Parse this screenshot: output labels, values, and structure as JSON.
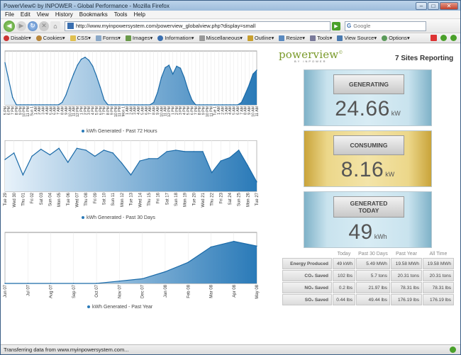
{
  "window": {
    "title": "PowerView© by INPOWER - Global Performance - Mozilla Firefox",
    "min": "–",
    "max": "□",
    "close": "✕"
  },
  "menu": [
    "File",
    "Edit",
    "View",
    "History",
    "Bookmarks",
    "Tools",
    "Help"
  ],
  "nav": {
    "back_icon": "back-arrow-icon",
    "url": "http://www.myinpowersystem.com/powerview_globalview.php?display=small",
    "search_placeholder": "Google",
    "search_engine": "G"
  },
  "devbar": [
    "Disable",
    "Cookies",
    "CSS",
    "Forms",
    "Images",
    "Information",
    "Miscellaneous",
    "Outline",
    "Resize",
    "Tools",
    "View Source",
    "Options"
  ],
  "status": "Transferring data from www.myinpowersystem.com...",
  "logo": {
    "name": "powerview",
    "mark": "©",
    "sub": "BY INPOWER"
  },
  "sites_reporting": "7 Sites Reporting",
  "panels": {
    "generating": {
      "label": "GENERATING",
      "value": "24.66",
      "unit": "kW"
    },
    "consuming": {
      "label": "CONSUMING",
      "value": "8.16",
      "unit": "kW"
    },
    "generated_today": {
      "label_line1": "GENERATED",
      "label_line2": "TODAY",
      "value": "49",
      "unit": "kWh"
    }
  },
  "stats": {
    "headers": [
      "Today",
      "Past 30 Days",
      "Past Year",
      "All Time"
    ],
    "rows": [
      {
        "label": "Energy Produced",
        "values": [
          "49 kWh",
          "5.49 MWh",
          "19.58 MWh",
          "19.58 MWh"
        ]
      },
      {
        "label": "CO₂ Saved",
        "values": [
          "102 lbs",
          "5.7 tons",
          "20.31 tons",
          "20.31 tons"
        ]
      },
      {
        "label": "NO₂ Saved",
        "values": [
          "0.2 lbs",
          "21.97 lbs",
          "78.31 lbs",
          "78.31 lbs"
        ]
      },
      {
        "label": "SO₂ Saved",
        "values": [
          "0.44 lbs",
          "49.44 lbs",
          "176.19 lbs",
          "176.19 lbs"
        ]
      }
    ]
  },
  "colors": {
    "fill": "#2a7ab8",
    "fill_light": "#e8f2fa",
    "line": "#1a6aa8",
    "gold": "#e6cf80",
    "blue_panel": "#c9e3ee"
  },
  "chart_data": [
    {
      "type": "area",
      "legend": "kWh Generated - Past 72 Hours",
      "x": [
        "5 PM",
        "6 PM",
        "7 PM",
        "8 PM",
        "9 PM",
        "10 PM",
        "11 PM",
        "Sun 1",
        "1 AM",
        "2 AM",
        "3 AM",
        "4 AM",
        "5 AM",
        "6 AM",
        "7 AM",
        "8 AM",
        "9 AM",
        "10 AM",
        "11 AM",
        "12 PM",
        "1 PM",
        "2 PM",
        "3 PM",
        "4 PM",
        "5 PM",
        "6 PM",
        "7 PM",
        "8 PM",
        "9 PM",
        "10 PM",
        "11 PM",
        "Mon 1",
        "1 AM",
        "2 AM",
        "3 AM",
        "4 AM",
        "5 AM",
        "6 AM",
        "7 AM",
        "8 AM",
        "9 AM",
        "10 AM",
        "11 AM",
        "12 PM",
        "1 PM",
        "2 PM",
        "3 PM",
        "4 PM",
        "5 PM",
        "6 PM",
        "7 PM",
        "8 PM",
        "9 PM",
        "10 PM",
        "11 PM",
        "Tue 1",
        "1 AM",
        "2 AM",
        "3 AM",
        "4 AM",
        "5 AM",
        "6 AM",
        "7 AM",
        "8 AM",
        "9 AM",
        "10 AM",
        "11 AM"
      ],
      "values": [
        0.85,
        0.5,
        0.15,
        0,
        0,
        0,
        0,
        0,
        0,
        0,
        0,
        0,
        0,
        0,
        0,
        0.05,
        0.2,
        0.42,
        0.62,
        0.8,
        0.92,
        0.96,
        0.9,
        0.78,
        0.58,
        0.35,
        0.1,
        0,
        0,
        0,
        0,
        0,
        0,
        0,
        0,
        0,
        0,
        0,
        0,
        0.05,
        0.25,
        0.55,
        0.75,
        0.8,
        0.62,
        0.78,
        0.74,
        0.55,
        0.3,
        0.1,
        0,
        0,
        0,
        0,
        0,
        0,
        0,
        0,
        0,
        0,
        0,
        0,
        0.05,
        0.22,
        0.4,
        0.62,
        0.7
      ],
      "ylim": [
        0,
        1
      ]
    },
    {
      "type": "area",
      "legend": "kWh Generated - Past 30 Days",
      "x": [
        "Tue 29",
        "Wed 30",
        "Thu 01",
        "Fri 02",
        "Sat 03",
        "Sun 04",
        "Mon 05",
        "Tue 06",
        "Wed 07",
        "Thu 08",
        "Fri 09",
        "Sat 10",
        "Sun 11",
        "Mon 12",
        "Tue 13",
        "Wed 14",
        "Thu 15",
        "Fri 16",
        "Sat 17",
        "Sun 18",
        "Mon 19",
        "Tue 20",
        "Wed 21",
        "Thu 22",
        "Fri 23",
        "Sat 24",
        "Sun 25",
        "Mon 26",
        "Tue 27"
      ],
      "values": [
        0.68,
        0.82,
        0.35,
        0.75,
        0.9,
        0.78,
        0.92,
        0.62,
        0.92,
        0.88,
        0.75,
        0.88,
        0.82,
        0.6,
        0.35,
        0.65,
        0.7,
        0.7,
        0.85,
        0.88,
        0.85,
        0.85,
        0.85,
        0.4,
        0.65,
        0.72,
        0.88,
        0.55,
        0.2
      ],
      "ylim": [
        0,
        1
      ]
    },
    {
      "type": "area",
      "legend": "kWh Generated - Past Year",
      "x": [
        "Jun 07",
        "Jul 07",
        "Aug 07",
        "Sep 07",
        "Oct 07",
        "Nov 07",
        "Dec 07",
        "Jan 08",
        "Feb 08",
        "Mar 08",
        "Apr 08",
        "May 08"
      ],
      "values": [
        0,
        0,
        0,
        0,
        0,
        0.05,
        0.1,
        0.25,
        0.45,
        0.78,
        0.9,
        0.8
      ],
      "ylim": [
        0,
        1
      ]
    }
  ]
}
